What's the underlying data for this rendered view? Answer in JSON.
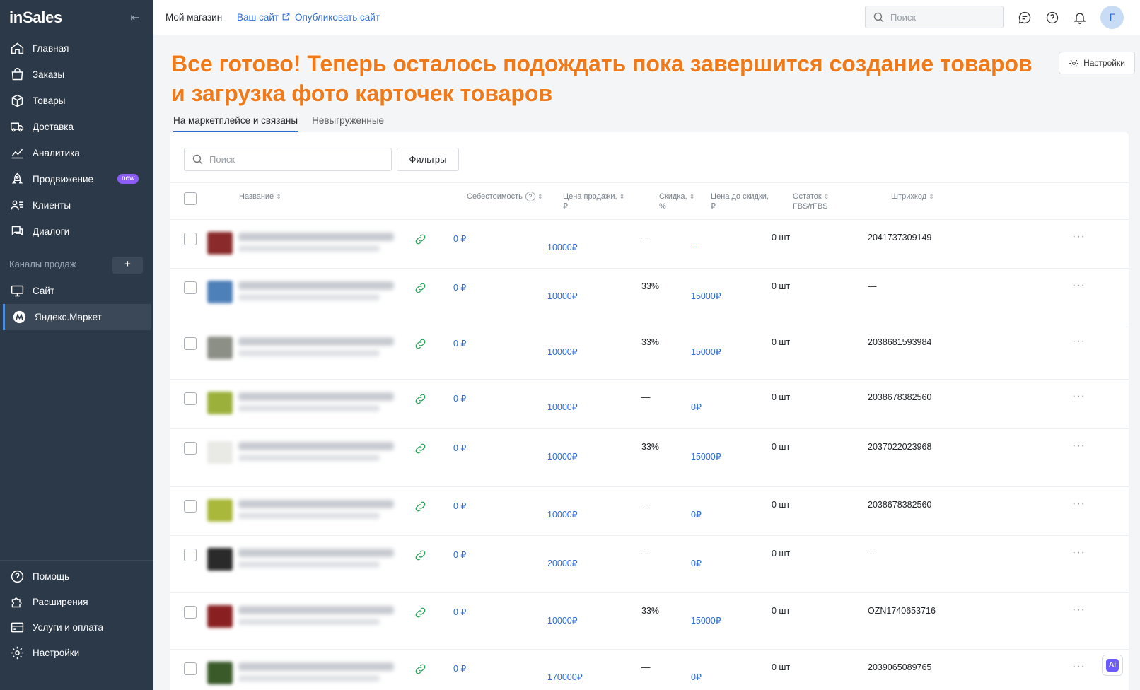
{
  "sidebar": {
    "logo": "inSales",
    "collapse_icon": "arrow-left-to-line-icon",
    "nav": [
      {
        "label": "Главная",
        "icon": "home-icon"
      },
      {
        "label": "Заказы",
        "icon": "shopping-bag-icon"
      },
      {
        "label": "Товары",
        "icon": "box-icon"
      },
      {
        "label": "Доставка",
        "icon": "truck-icon"
      },
      {
        "label": "Аналитика",
        "icon": "chart-line-icon"
      },
      {
        "label": "Продвижение",
        "icon": "rocket-icon",
        "badge": "new"
      },
      {
        "label": "Клиенты",
        "icon": "users-icon"
      },
      {
        "label": "Диалоги",
        "icon": "chat-icon"
      }
    ],
    "channels_title": "Каналы продаж",
    "channels_add": "+",
    "channels": [
      {
        "label": "Сайт",
        "icon": "monitor-icon"
      },
      {
        "label": "Яндекс.Маркет",
        "icon": "yandex-market-icon",
        "active": true
      }
    ],
    "bottom": [
      {
        "label": "Помощь",
        "icon": "help-circle-icon"
      },
      {
        "label": "Расширения",
        "icon": "puzzle-icon"
      },
      {
        "label": "Услуги и оплата",
        "icon": "credit-card-icon"
      },
      {
        "label": "Настройки",
        "icon": "gear-icon"
      }
    ]
  },
  "topbar": {
    "store": "Мой магазин",
    "site_link": "Ваш сайт",
    "publish_link": "Опубликовать сайт",
    "search_placeholder": "Поиск",
    "avatar_letter": "Г"
  },
  "banner_text": "Все готово! Теперь осталось подождать пока завершится создание товаров и загрузка фото карточек товаров",
  "settings_label": "Настройки",
  "tabs": [
    {
      "label": "На маркетплейсе и связаны",
      "active": true
    },
    {
      "label": "Невыгруженные",
      "active": false
    }
  ],
  "toolbar": {
    "search_placeholder": "Поиск",
    "filters_label": "Фильтры"
  },
  "columns": {
    "name": "Название",
    "cost": "Себестоимость",
    "price_line1": "Цена продажи,",
    "price_line2": "₽",
    "discount_line1": "Скидка,",
    "discount_line2": "%",
    "price_before_line1": "Цена до скидки,",
    "price_before_line2": "₽",
    "stock_line1": "Остаток",
    "stock_line2": "FBS/rFBS",
    "barcode": "Штрихкод"
  },
  "rows": [
    {
      "cost": "0 ₽",
      "price": "10000₽",
      "discount": "—",
      "price_before": "—",
      "stock": "0 шт",
      "barcode": "2041737309149",
      "thumb_color": "#8a2a2a",
      "height": 69
    },
    {
      "cost": "0 ₽",
      "price": "10000₽",
      "discount": "33%",
      "price_before": "15000₽",
      "stock": "0 шт",
      "barcode": "—",
      "thumb_color": "#4d7fb8",
      "height": 79
    },
    {
      "cost": "0 ₽",
      "price": "10000₽",
      "discount": "33%",
      "price_before": "15000₽",
      "stock": "0 шт",
      "barcode": "2038681593984",
      "thumb_color": "#8c8f86",
      "height": 78
    },
    {
      "cost": "0 ₽",
      "price": "10000₽",
      "discount": "—",
      "price_before": "0₽",
      "stock": "0 шт",
      "barcode": "2038678382560",
      "thumb_color": "#9bb03a",
      "height": 70
    },
    {
      "cost": "0 ₽",
      "price": "10000₽",
      "discount": "33%",
      "price_before": "15000₽",
      "stock": "0 шт",
      "barcode": "2037022023968",
      "thumb_color": "#e9e9e6",
      "height": 82
    },
    {
      "cost": "0 ₽",
      "price": "10000₽",
      "discount": "—",
      "price_before": "0₽",
      "stock": "0 шт",
      "barcode": "2038678382560",
      "thumb_color": "#a9b83a",
      "height": 69
    },
    {
      "cost": "0 ₽",
      "price": "20000₽",
      "discount": "—",
      "price_before": "0₽",
      "stock": "0 шт",
      "barcode": "—",
      "thumb_color": "#2a2a2a",
      "height": 81
    },
    {
      "cost": "0 ₽",
      "price": "10000₽",
      "discount": "33%",
      "price_before": "15000₽",
      "stock": "0 шт",
      "barcode": "OZN1740653716",
      "thumb_color": "#8a1f22",
      "height": 80
    },
    {
      "cost": "0 ₽",
      "price": "170000₽",
      "discount": "—",
      "price_before": "0₽",
      "stock": "0 шт",
      "barcode": "2039065089765",
      "thumb_color": "#3a5a2a",
      "height": 80
    }
  ],
  "ai_button": "Ai"
}
